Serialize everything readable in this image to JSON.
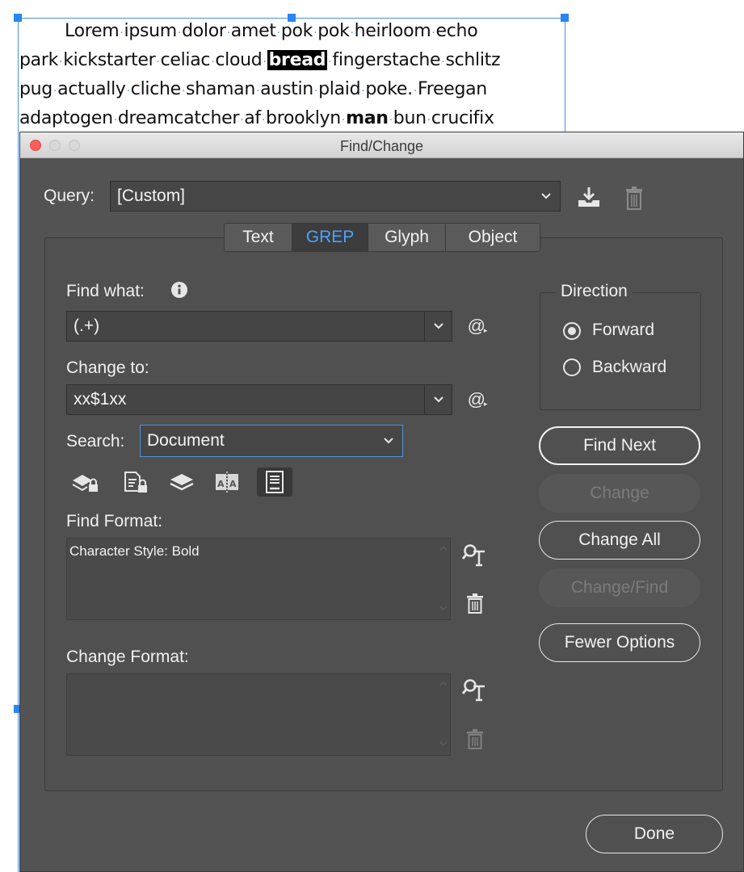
{
  "document": {
    "lines": [
      [
        "Lorem",
        "ipsum",
        "dolor",
        "amet",
        "pok",
        "pok",
        "heirloom",
        "echo"
      ],
      [
        "park",
        "kickstarter",
        "celiac",
        "cloud",
        "bread",
        "fingerstache",
        "schlitz"
      ],
      [
        "pug",
        "actually",
        "cliche",
        "shaman",
        "austin",
        "plaid",
        "poke.",
        "Freegan"
      ],
      [
        "adaptogen",
        "dreamcatcher",
        "af",
        "brooklyn",
        "man",
        "bun",
        "crucifix"
      ]
    ],
    "highlighted_word": "bread",
    "bold_word": "man"
  },
  "window": {
    "title": "Find/Change"
  },
  "query": {
    "label": "Query:",
    "value": "[Custom]"
  },
  "tabs": [
    {
      "label": "Text",
      "active": false
    },
    {
      "label": "GREP",
      "active": true
    },
    {
      "label": "Glyph",
      "active": false
    },
    {
      "label": "Object",
      "active": false
    }
  ],
  "find_what": {
    "label": "Find what:",
    "value": "(.+)"
  },
  "change_to": {
    "label": "Change to:",
    "value": "xx$1xx"
  },
  "search": {
    "label": "Search:",
    "value": "Document"
  },
  "find_format": {
    "label": "Find Format:",
    "value": "Character Style: Bold"
  },
  "change_format": {
    "label": "Change Format:",
    "value": ""
  },
  "direction": {
    "label": "Direction",
    "options": [
      {
        "label": "Forward",
        "selected": true
      },
      {
        "label": "Backward",
        "selected": false
      }
    ]
  },
  "buttons": {
    "find_next": "Find Next",
    "change": "Change",
    "change_all": "Change All",
    "change_find": "Change/Find",
    "fewer_options": "Fewer Options",
    "done": "Done"
  },
  "colors": {
    "accent": "#4aa3ff",
    "dialog_bg": "#535353",
    "selection_handle": "#2a86f0"
  }
}
